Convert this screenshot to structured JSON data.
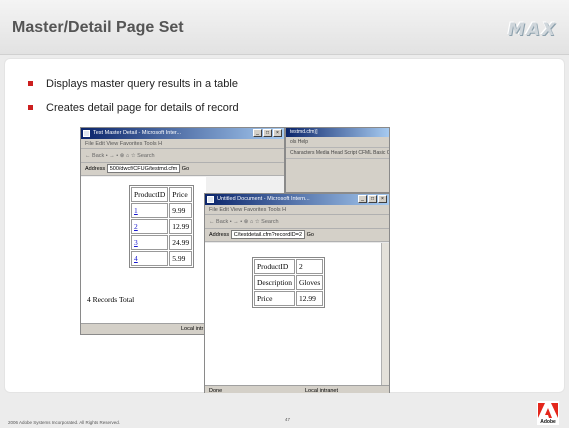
{
  "header": {
    "title": "Master/Detail Page Set",
    "logo_text": "MAX"
  },
  "bullets": [
    "Displays master query results in a table",
    "Creates detail page for details of record"
  ],
  "master_window": {
    "title": "Test Master Detail - Microsoft Inter...",
    "menu": "File  Edit  View  Favorites  Tools  H",
    "toolbar": "← Back  •  →  •   ⊗  ⌂  ☆   Search",
    "address_label": "Address",
    "address_value": "500/dwcf/CFUG/testmd.cfm",
    "go_label": "Go",
    "table_headers": [
      "ProductID",
      "Price"
    ],
    "rows": [
      {
        "id": "1",
        "price": "9.99"
      },
      {
        "id": "2",
        "price": "12.99"
      },
      {
        "id": "3",
        "price": "24.99"
      },
      {
        "id": "4",
        "price": "5.99"
      }
    ],
    "total_text": "4 Records Total",
    "status_right": "Local intr"
  },
  "background_strip": {
    "title": "testmd.cfm)]",
    "menu": "ols  Help",
    "toolbar": "Characters  Media  Head  Script  CFML Basic  C"
  },
  "detail_window": {
    "title": "Untitled Document - Microsoft Intern...",
    "menu": "File  Edit  View  Favorites  Tools  H",
    "toolbar": "← Back  •  →  •   ⊗  ⌂  ☆   Search",
    "address_label": "Address",
    "address_value": "C/testdetail.cfm?recordID=2",
    "go_label": "Go",
    "fields": [
      {
        "label": "ProductID",
        "value": "2"
      },
      {
        "label": "Description",
        "value": "Gloves"
      },
      {
        "label": "Price",
        "value": "12.99"
      }
    ],
    "status_left": "Done",
    "status_right": "Local intranet"
  },
  "footer": {
    "copyright": "2006 Adobe Systems Incorporated.  All Rights Reserved.",
    "page_number": "47",
    "brand": "Adobe"
  },
  "colors": {
    "bullet": "#cc1f1f",
    "titlebar": "#0a246a",
    "adobe_red": "#e3261b"
  }
}
